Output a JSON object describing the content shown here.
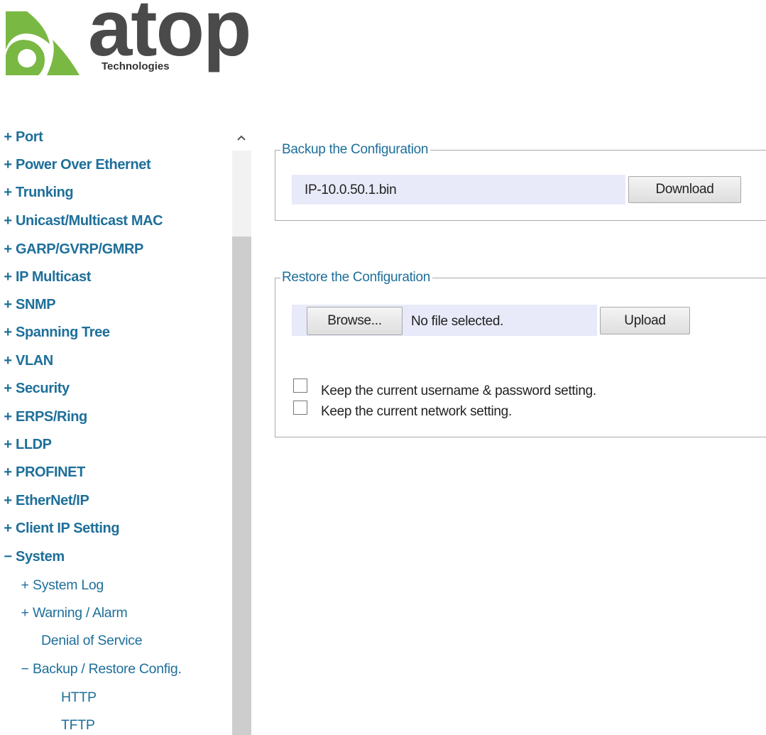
{
  "logo": {
    "brand": "atop",
    "subtitle": "Technologies",
    "colors": {
      "green": "#7ab844",
      "gray": "#4a4a4a"
    }
  },
  "sidebar": {
    "items": [
      {
        "sign": "+",
        "label": "Port"
      },
      {
        "sign": "+",
        "label": "Power Over Ethernet"
      },
      {
        "sign": "+",
        "label": "Trunking"
      },
      {
        "sign": "+",
        "label": "Unicast/Multicast MAC"
      },
      {
        "sign": "+",
        "label": "GARP/GVRP/GMRP"
      },
      {
        "sign": "+",
        "label": "IP Multicast"
      },
      {
        "sign": "+",
        "label": "SNMP"
      },
      {
        "sign": "+",
        "label": "Spanning Tree"
      },
      {
        "sign": "+",
        "label": "VLAN"
      },
      {
        "sign": "+",
        "label": "Security"
      },
      {
        "sign": "+",
        "label": "ERPS/Ring"
      },
      {
        "sign": "+",
        "label": "LLDP"
      },
      {
        "sign": "+",
        "label": "PROFINET"
      },
      {
        "sign": "+",
        "label": "EtherNet/IP"
      },
      {
        "sign": "+",
        "label": "Client IP Setting"
      },
      {
        "sign": "−",
        "label": "System"
      }
    ],
    "system_children": [
      {
        "sign": "+",
        "label": "System Log"
      },
      {
        "sign": "+",
        "label": "Warning / Alarm"
      },
      {
        "sign": "",
        "label": "Denial of Service"
      },
      {
        "sign": "−",
        "label": "Backup / Restore Config."
      }
    ],
    "backup_children": [
      {
        "label": "HTTP"
      },
      {
        "label": "TFTP"
      }
    ],
    "scroll_up_icon": "chevron-up-icon",
    "link_color": "#1e6f9a"
  },
  "backup": {
    "legend": "Backup the Configuration",
    "filename": "IP-10.0.50.1.bin",
    "download_label": "Download"
  },
  "restore": {
    "legend": "Restore the Configuration",
    "browse_label": "Browse...",
    "file_status": "No file selected.",
    "upload_label": "Upload",
    "keep_user_label": "Keep the current username & password setting.",
    "keep_network_label": "Keep the current network setting.",
    "keep_user_checked": false,
    "keep_network_checked": false
  },
  "colors": {
    "file_bar": "#e8eaf9",
    "border": "#a9a9a9"
  }
}
